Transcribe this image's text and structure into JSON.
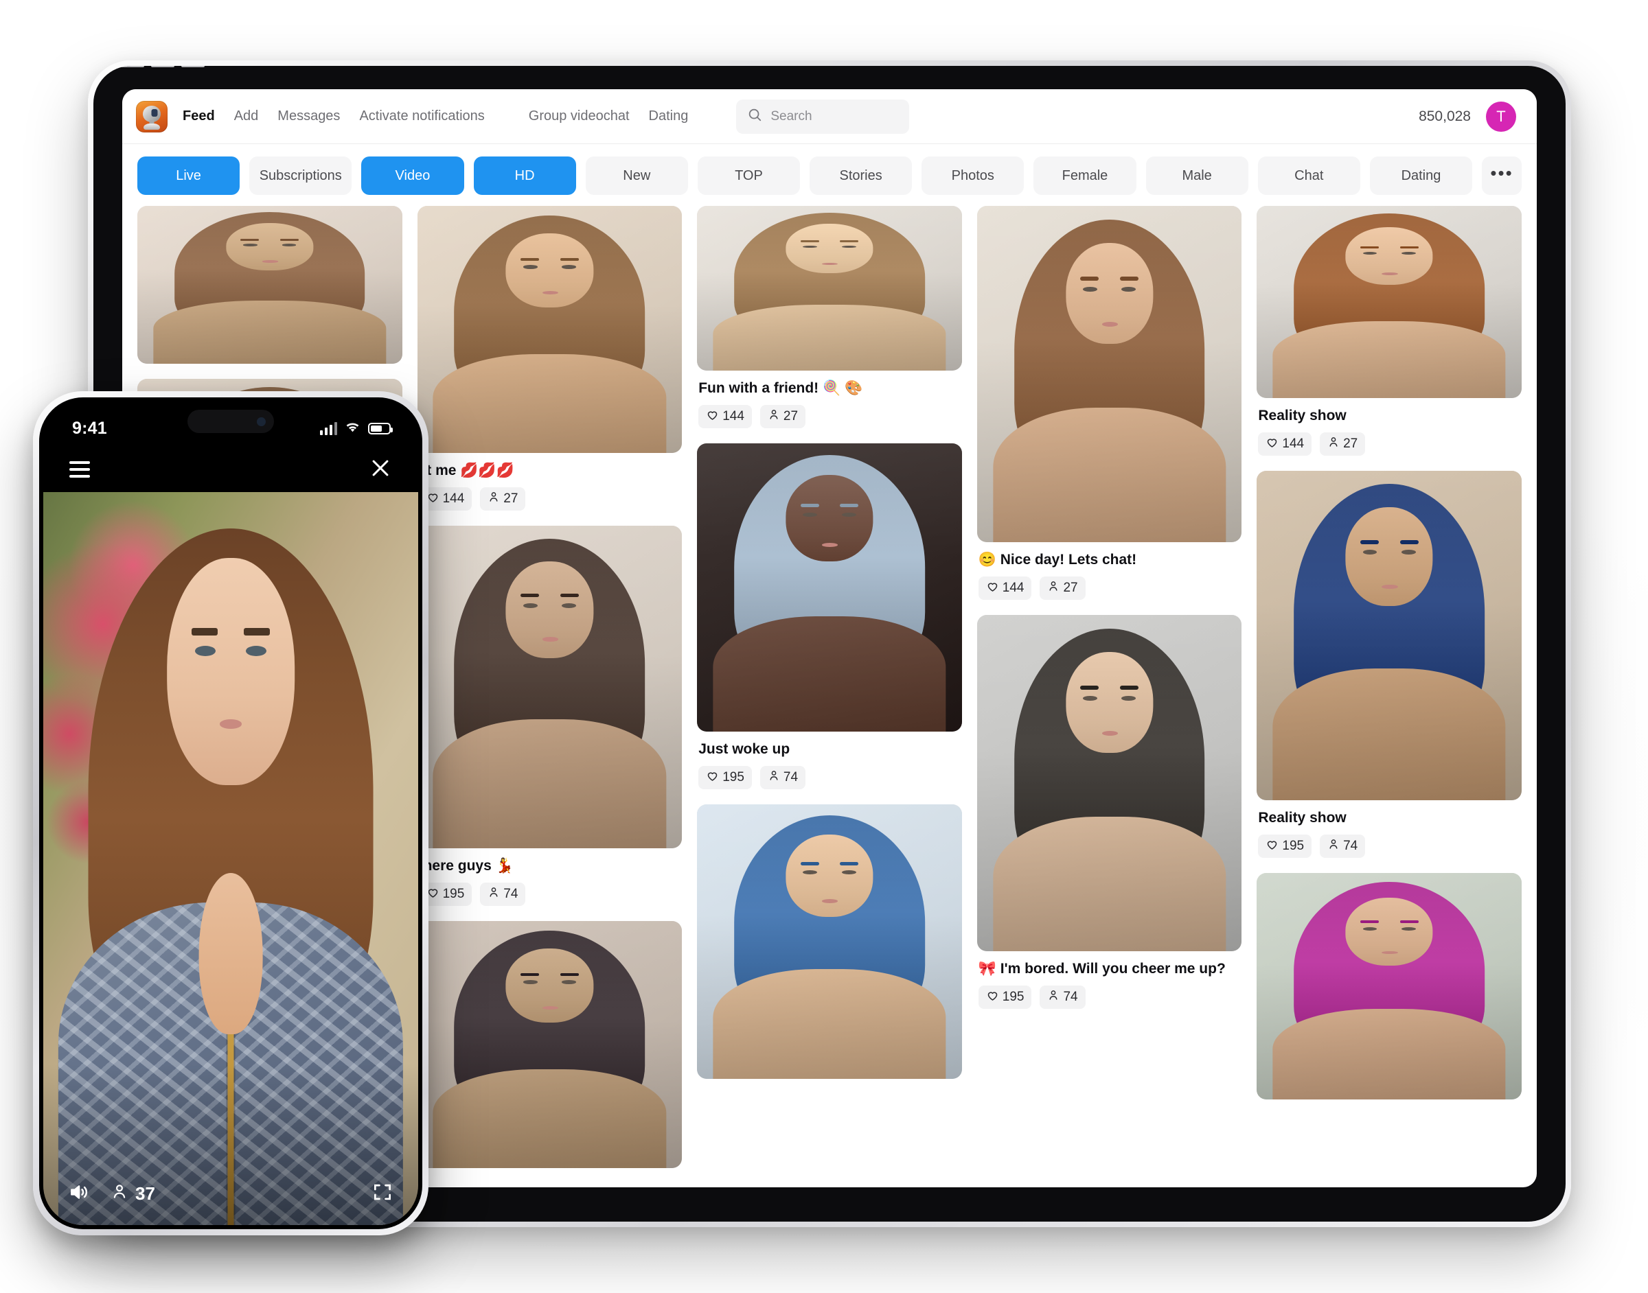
{
  "app": {
    "logo_icon": "webcam-logo-icon",
    "coin_count": "850,028",
    "avatar_initial": "T",
    "avatar_color": "#d626b4",
    "accent_color": "#1f93f0"
  },
  "search": {
    "placeholder": "Search",
    "value": "",
    "icon": "search-icon"
  },
  "nav": {
    "items": [
      {
        "label": "Feed",
        "active": true
      },
      {
        "label": "Add",
        "active": false
      },
      {
        "label": "Messages",
        "active": false
      },
      {
        "label": "Activate notifications",
        "active": false
      },
      {
        "label": "Group videochat",
        "active": false
      },
      {
        "label": "Dating",
        "active": false
      }
    ]
  },
  "chips": [
    {
      "label": "Live",
      "selected": true
    },
    {
      "label": "Subscriptions",
      "selected": false
    },
    {
      "label": "Video",
      "selected": true
    },
    {
      "label": "HD",
      "selected": true
    },
    {
      "label": "New",
      "selected": false
    },
    {
      "label": "TOP",
      "selected": false
    },
    {
      "label": "Stories",
      "selected": false
    },
    {
      "label": "Photos",
      "selected": false
    },
    {
      "label": "Female",
      "selected": false
    },
    {
      "label": "Male",
      "selected": false
    },
    {
      "label": "Chat",
      "selected": false
    },
    {
      "label": "Dating",
      "selected": false
    },
    {
      "label": "•••",
      "selected": false,
      "more": true
    }
  ],
  "feed": {
    "columns": [
      {
        "cards": [
          {
            "caption": "",
            "likes": "",
            "viewers": "",
            "thumb_h": 230,
            "palette": [
              "#e8ddd2",
              "#caa882",
              "#8c6547"
            ]
          },
          {
            "caption": "",
            "likes": "",
            "viewers": "",
            "thumb_h": 300,
            "palette": [
              "#ded3c6",
              "#c9a07a",
              "#7e5b3d"
            ]
          },
          {
            "caption": "",
            "likes": "",
            "viewers": "",
            "thumb_h": 300,
            "palette": [
              "#d8cfc6",
              "#b58f6d",
              "#6f4f36"
            ]
          }
        ]
      },
      {
        "cards": [
          {
            "caption": "st me 💋💋💋",
            "likes": "144",
            "viewers": "27",
            "thumb_h": 360,
            "palette": [
              "#e6d9c9",
              "#d8b089",
              "#8e6743"
            ]
          },
          {
            "caption": "there guys 💃",
            "likes": "195",
            "viewers": "74",
            "thumb_h": 470,
            "palette": [
              "#dfd6cc",
              "#c2a183",
              "#4a3a32"
            ]
          },
          {
            "caption": "",
            "likes": "",
            "viewers": "",
            "thumb_h": 360,
            "palette": [
              "#cfc3b8",
              "#b99a78",
              "#3a3034"
            ]
          }
        ]
      },
      {
        "cards": [
          {
            "caption": "Fun with a friend! 🍭 🎨",
            "likes": "144",
            "viewers": "27",
            "thumb_h": 240,
            "palette": [
              "#e9e4dd",
              "#e3c49f",
              "#a07c55"
            ]
          },
          {
            "caption": "Just woke up",
            "likes": "195",
            "viewers": "74",
            "thumb_h": 420,
            "palette": [
              "#3c3230",
              "#6b4a3c",
              "#9fb2c4"
            ]
          },
          {
            "caption": "",
            "likes": "",
            "viewers": "",
            "thumb_h": 400,
            "palette": [
              "#dbe6ef",
              "#dcb894",
              "#3f6fa8"
            ]
          }
        ]
      },
      {
        "cards": [
          {
            "caption": "😊 Nice day! Lets chat!",
            "likes": "144",
            "viewers": "27",
            "thumb_h": 490,
            "palette": [
              "#e7e0d6",
              "#d8b08d",
              "#8a5f3e"
            ]
          },
          {
            "caption": "🎀 I'm bored. Will you cheer me up?",
            "likes": "195",
            "viewers": "74",
            "thumb_h": 490,
            "palette": [
              "#cfcfcd",
              "#d6b79a",
              "#3b3733"
            ]
          }
        ]
      },
      {
        "cards": [
          {
            "caption": "Reality show",
            "likes": "144",
            "viewers": "27",
            "thumb_h": 280,
            "palette": [
              "#e6e2dc",
              "#dfb894",
              "#9c5f34"
            ]
          },
          {
            "caption": "Reality show",
            "likes": "195",
            "viewers": "74",
            "thumb_h": 480,
            "palette": [
              "#d4c3ad",
              "#c79f79",
              "#25407a"
            ]
          },
          {
            "caption": "",
            "likes": "",
            "viewers": "",
            "thumb_h": 330,
            "palette": [
              "#cfd7cc",
              "#d3ab8a",
              "#b12f96"
            ]
          }
        ]
      }
    ]
  },
  "phone": {
    "status": {
      "time": "9:41",
      "signal_icon": "cellular-signal-icon",
      "wifi_icon": "wifi-icon",
      "battery_icon": "battery-icon"
    },
    "topbar": {
      "menu_icon": "hamburger-menu-icon",
      "close_icon": "close-icon"
    },
    "bottombar": {
      "sound_icon": "speaker-volume-icon",
      "viewer_icon": "person-icon",
      "viewer_count": "37",
      "fullscreen_icon": "fullscreen-icon"
    }
  },
  "icons": {
    "heart": "heart-icon",
    "person": "person-icon"
  }
}
